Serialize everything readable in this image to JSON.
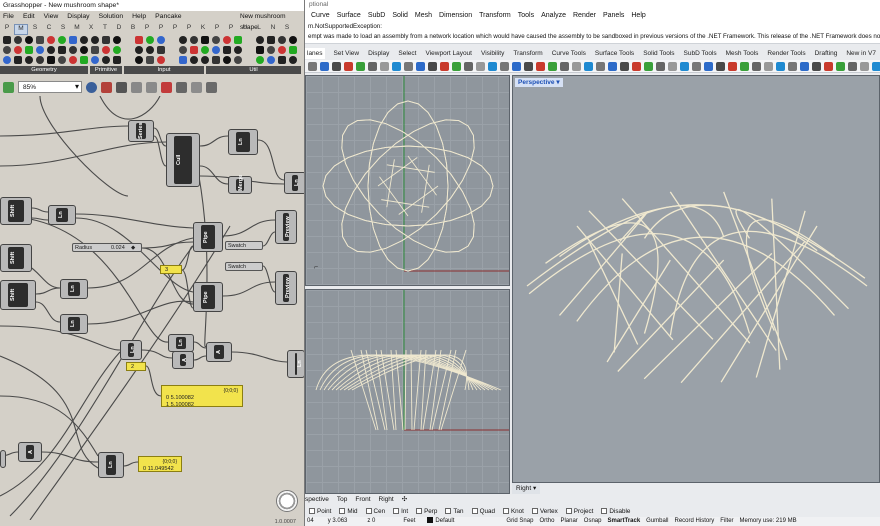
{
  "grasshopper": {
    "title": "Grasshopper - New mushroom shape*",
    "doc_name": "New mushroom shape",
    "menu": [
      "File",
      "Edit",
      "View",
      "Display",
      "Solution",
      "Help",
      "Pancake"
    ],
    "component_tabs": [
      "P",
      "M",
      "S",
      "C",
      "S",
      "M",
      "X",
      "T",
      "D",
      "B",
      "P",
      "P",
      "P",
      "P",
      "K",
      "P",
      "P",
      "U",
      "L",
      "N",
      "S"
    ],
    "ribbon_groups": [
      "Geometry",
      "Primitive",
      "Input",
      "Util"
    ],
    "zoom": "85%",
    "components": {
      "series": "Series",
      "cull": "Cull",
      "ln_top": "Ln",
      "merge": "Merge",
      "shift1": "Shift",
      "ln1": "Ln",
      "shift2": "Shift",
      "shift3": "Shift",
      "ln2": "Ln",
      "ln3": "Ln",
      "pipe1": "Pipe",
      "pipe2": "Pipe",
      "preview1": "Preview",
      "preview2": "Preview",
      "ln4": "Ln",
      "ln5": "Ln",
      "a1": "A",
      "a2": "A",
      "ln6": "Ln",
      "a3": "A",
      "ln7": "Ln"
    },
    "radius_label": "Radius",
    "radius_value": "0.024",
    "swatch_label": "Swatch",
    "panel_value": "3",
    "panel2_value": "2",
    "panel1": {
      "path": "{0;0;0}",
      "line0": "0 5.100082",
      "line1": "1 5.100082"
    },
    "panel3": {
      "path": "{0;0;0}",
      "line0": "0 11.049542"
    },
    "status": "1.0.0007"
  },
  "rhino": {
    "title": "ptional",
    "menu": [
      "Curve",
      "Surface",
      "SubD",
      "Solid",
      "Mesh",
      "Dimension",
      "Transform",
      "Tools",
      "Analyze",
      "Render",
      "Panels",
      "Help"
    ],
    "command_line1": "m.NotSupportedException:",
    "command_line2": "empt was made to load an assembly from a network location which would have caused the assembly to be sandboxed in previous versions of the .NET Framework. This release of the .NET Framework does not enable CAS p",
    "toolbar_tabs": [
      "lanes",
      "Set View",
      "Display",
      "Select",
      "Viewport Layout",
      "Visibility",
      "Transform",
      "Curve Tools",
      "Surface Tools",
      "Solid Tools",
      "SubD Tools",
      "Mesh Tools",
      "Render Tools",
      "Drafting",
      "New in V7"
    ],
    "perspective_label": "Perspective",
    "right_label": "Right",
    "viewport_tabs": [
      "spective",
      "Top",
      "Front",
      "Right"
    ],
    "osnaps": [
      "Point",
      "Mid",
      "Cen",
      "Int",
      "Perp",
      "Tan",
      "Quad",
      "Knot",
      "Vertex",
      "Project",
      "Disable"
    ],
    "status": {
      "x": "04",
      "y": "y 3.063",
      "z": "z 0",
      "units": "Feet",
      "layer": "Default",
      "grid_snap": "Grid Snap",
      "ortho": "Ortho",
      "planar": "Planar",
      "osnap": "Osnap",
      "smarttrack": "SmartTrack",
      "gumball": "Gumball",
      "record_history": "Record History",
      "filter": "Filter",
      "memory": "Memory use: 219 MB"
    }
  }
}
